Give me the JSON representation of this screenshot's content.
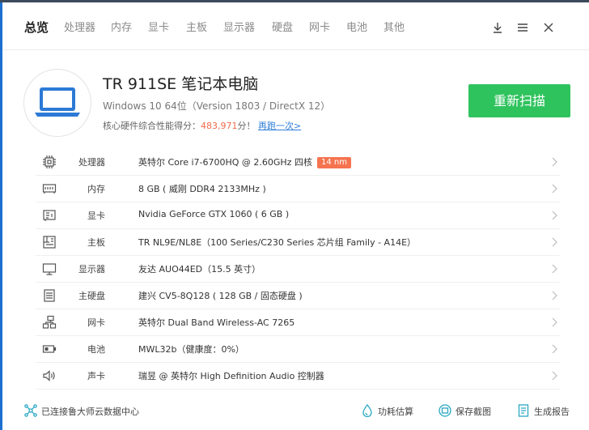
{
  "nav": {
    "tabs": [
      {
        "label": "总览",
        "active": true
      },
      {
        "label": "处理器"
      },
      {
        "label": "内存"
      },
      {
        "label": "显卡"
      },
      {
        "label": "主板"
      },
      {
        "label": "显示器"
      },
      {
        "label": "硬盘"
      },
      {
        "label": "网卡"
      },
      {
        "label": "电池"
      },
      {
        "label": "其他"
      }
    ]
  },
  "header": {
    "title": "TR 911SE 笔记本电脑",
    "subtitle": "Windows 10 64位（Version 1803 / DirectX 12）",
    "score_prefix": "核心硬件综合性能得分：",
    "score": "483,971",
    "score_suffix": "分！",
    "retest": "再跑一次>",
    "rescan_label": "重新扫描"
  },
  "hardware": [
    {
      "icon": "cpu-icon",
      "label": "处理器",
      "value": "英特尔 Core i7-6700HQ @ 2.60GHz 四核",
      "badge": "14 nm"
    },
    {
      "icon": "memory-icon",
      "label": "内存",
      "value": "8 GB ( 威刚 DDR4 2133MHz )"
    },
    {
      "icon": "gpu-icon",
      "label": "显卡",
      "value": "Nvidia GeForce GTX 1060 ( 6 GB )"
    },
    {
      "icon": "motherboard-icon",
      "label": "主板",
      "value": "TR NL9E/NL8E（100 Series/C230 Series 芯片组 Family - A14E）"
    },
    {
      "icon": "monitor-icon",
      "label": "显示器",
      "value": "友达 AUO44ED（15.5 英寸）"
    },
    {
      "icon": "harddisk-icon",
      "label": "主硬盘",
      "value": "建兴 CV5-8Q128 ( 128 GB / 固态硬盘 )"
    },
    {
      "icon": "network-icon",
      "label": "网卡",
      "value": "英特尔 Dual Band Wireless-AC 7265"
    },
    {
      "icon": "battery-icon",
      "label": "电池",
      "value": "MWL32b（健康度：0%）"
    },
    {
      "icon": "speaker-icon",
      "label": "声卡",
      "value": "瑞昱 @ 英特尔 High Definition Audio 控制器"
    }
  ],
  "footer": {
    "cloud_status": "已连接鲁大师云数据中心",
    "power_estimate": "功耗估算",
    "save_screenshot": "保存截图",
    "generate_report": "生成报告"
  },
  "colors": {
    "accent_green": "#2fc35e",
    "score_red": "#f06a4a",
    "badge_orange": "#f5734f",
    "link_blue": "#2f7fd8",
    "laptop_blue": "#2d7ad6",
    "footer_teal": "#2aa8c4"
  }
}
